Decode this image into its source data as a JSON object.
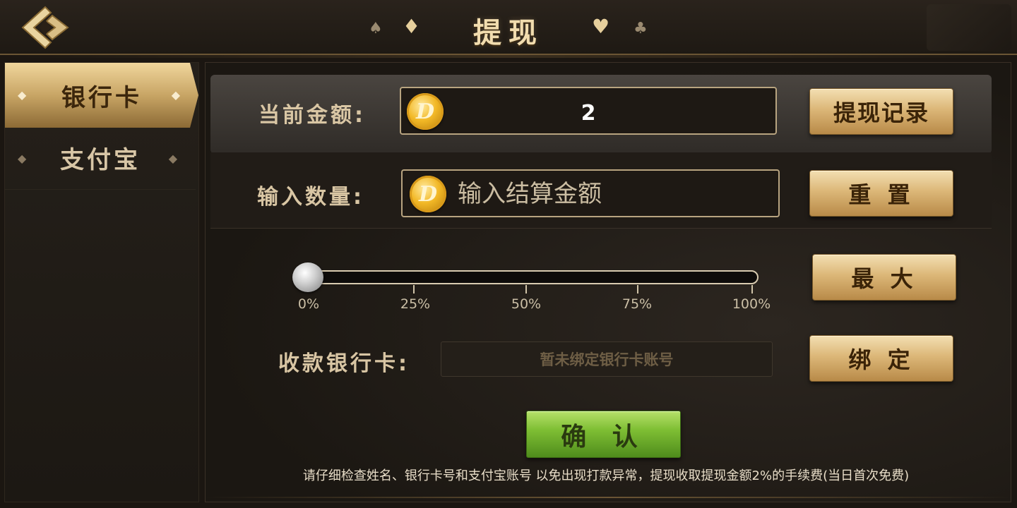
{
  "header": {
    "title": "提现",
    "suits_left": [
      "♠",
      "♦"
    ],
    "suits_right": [
      "♥",
      "♣"
    ]
  },
  "sidebar": {
    "items": [
      {
        "label": "银行卡",
        "active": true
      },
      {
        "label": "支付宝",
        "active": false
      }
    ],
    "arrow_left": "◆",
    "arrow_right": "◆"
  },
  "form": {
    "current_amount_label": "当前金额:",
    "current_amount_value": "2",
    "coin_glyph": "D",
    "input_label": "输入数量:",
    "input_placeholder": "输入结算金额",
    "slider": {
      "value": 0,
      "ticks": [
        "0%",
        "25%",
        "50%",
        "75%",
        "100%"
      ]
    },
    "bank_label": "收款银行卡:",
    "bank_value": "暂未绑定银行卡账号"
  },
  "buttons": {
    "history": "提现记录",
    "reset": "重 置",
    "max": "最 大",
    "bind": "绑 定",
    "confirm": "确 认"
  },
  "notice": "请仔细检查姓名、银行卡号和支付宝账号 以免出现打款异常，提现收取提现金额2%的手续费(当日首次免费)",
  "colors": {
    "gold": "#dcb778",
    "green": "#7fbf34",
    "background": "#1b1611"
  }
}
